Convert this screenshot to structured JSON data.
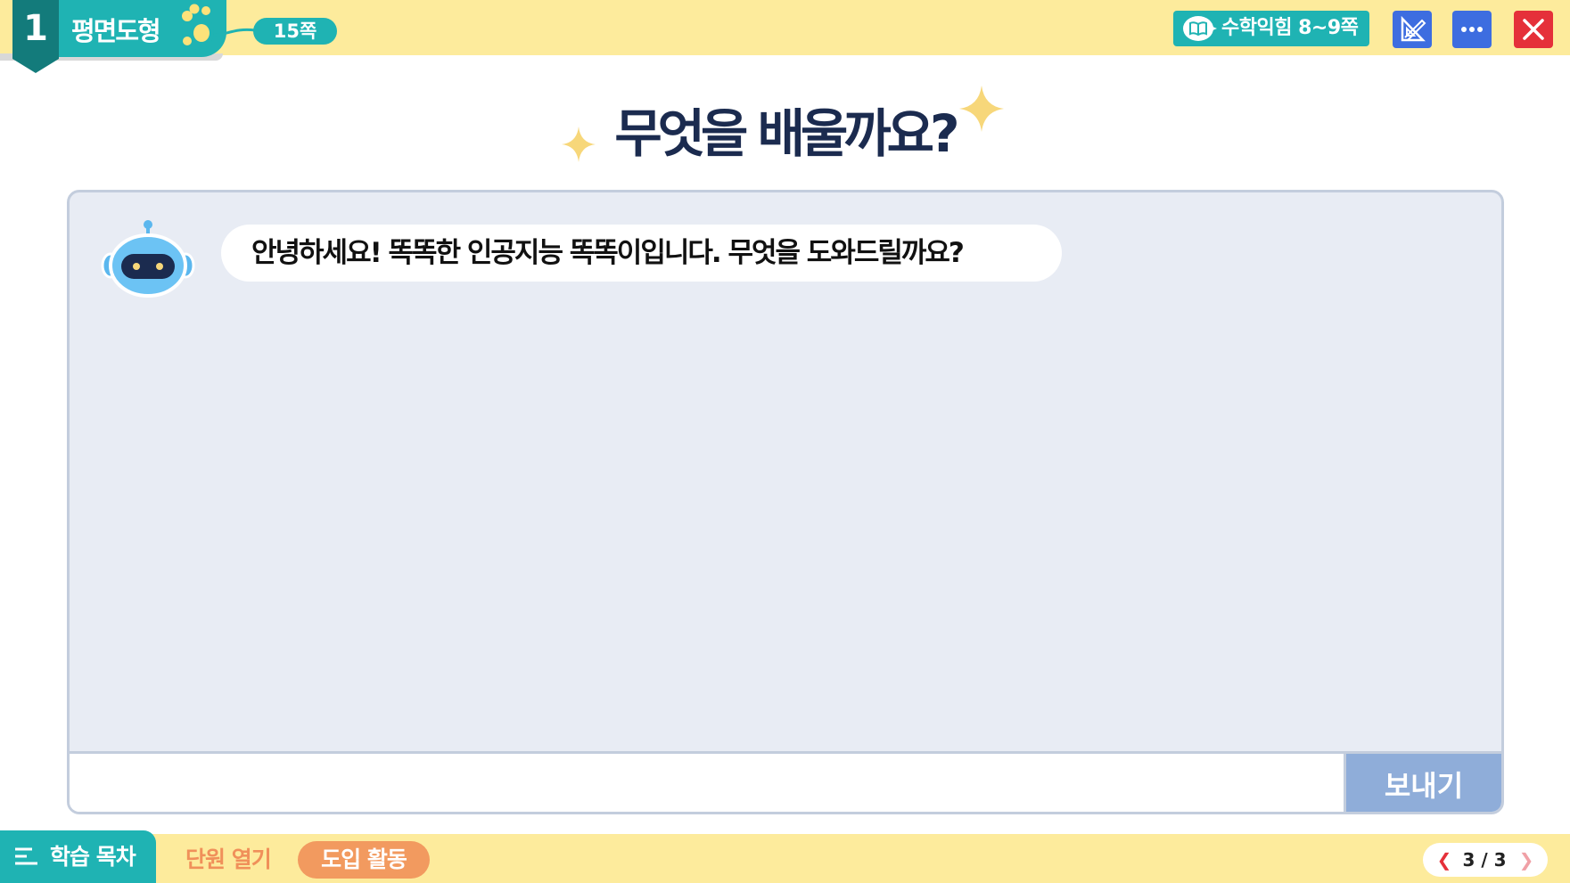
{
  "header": {
    "unit_number": "1",
    "unit_title": "평면도형",
    "page_label": "15쪽",
    "book_button_label": "수학익힘 8~9쪽",
    "icons": {
      "book": "book-icon",
      "tools": "ruler-triangle-icon",
      "more": "more-dots-icon",
      "close": "close-icon"
    },
    "colors": {
      "bar": "#fdeb9c",
      "teal": "#1fb3b3",
      "blue": "#3d6de0",
      "red": "#e5303a"
    }
  },
  "main": {
    "title": "무엇을 배울까요?"
  },
  "chat": {
    "messages": [
      {
        "sender": "robot",
        "text": "안녕하세요! 똑똑한 인공지능 똑똑이입니다. 무엇을 도와드릴까요?"
      }
    ],
    "input_value": "",
    "send_label": "보내기"
  },
  "footer": {
    "toc_label": "학습 목차",
    "tabs": [
      {
        "label": "단원 열기",
        "active": false
      },
      {
        "label": "도입 활동",
        "active": true
      }
    ],
    "pager": {
      "text": "3 / 3",
      "current": 3,
      "total": 3
    }
  }
}
